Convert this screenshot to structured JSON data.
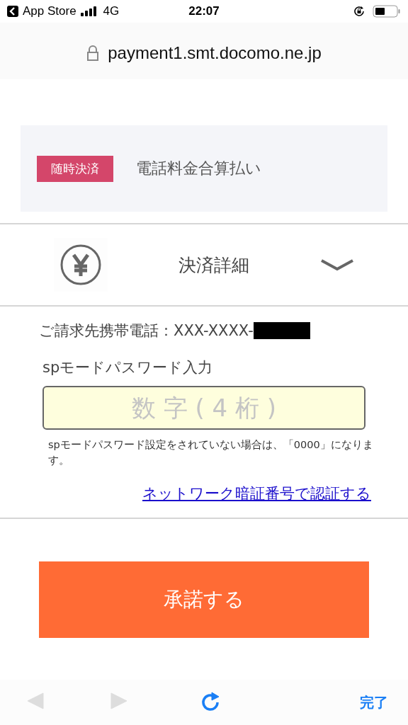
{
  "status_bar": {
    "back_app": "App Store",
    "network": "4G",
    "time": "22:07"
  },
  "address_bar": {
    "url": "payment1.smt.docomo.ne.jp"
  },
  "header": {
    "badge": "随時決済",
    "title": "電話料金合算払い"
  },
  "details": {
    "title": "決済詳細",
    "expanded": false
  },
  "billing": {
    "label": "ご請求先携帯電話：XXX-XXXX-",
    "redacted": true
  },
  "password": {
    "label": "spモードパスワード入力",
    "placeholder": "数 字 ( 4 桁 )",
    "note": "spモードパスワード設定をされていない場合は、「0000」になります。",
    "link": "ネットワーク暗証番号で認証する"
  },
  "submit": "承諾する",
  "toolbar": {
    "items": [
      {
        "kind": "back",
        "disabled": true
      },
      {
        "kind": "forward",
        "disabled": true
      },
      {
        "kind": "reload",
        "disabled": false
      }
    ],
    "done": "完了"
  }
}
